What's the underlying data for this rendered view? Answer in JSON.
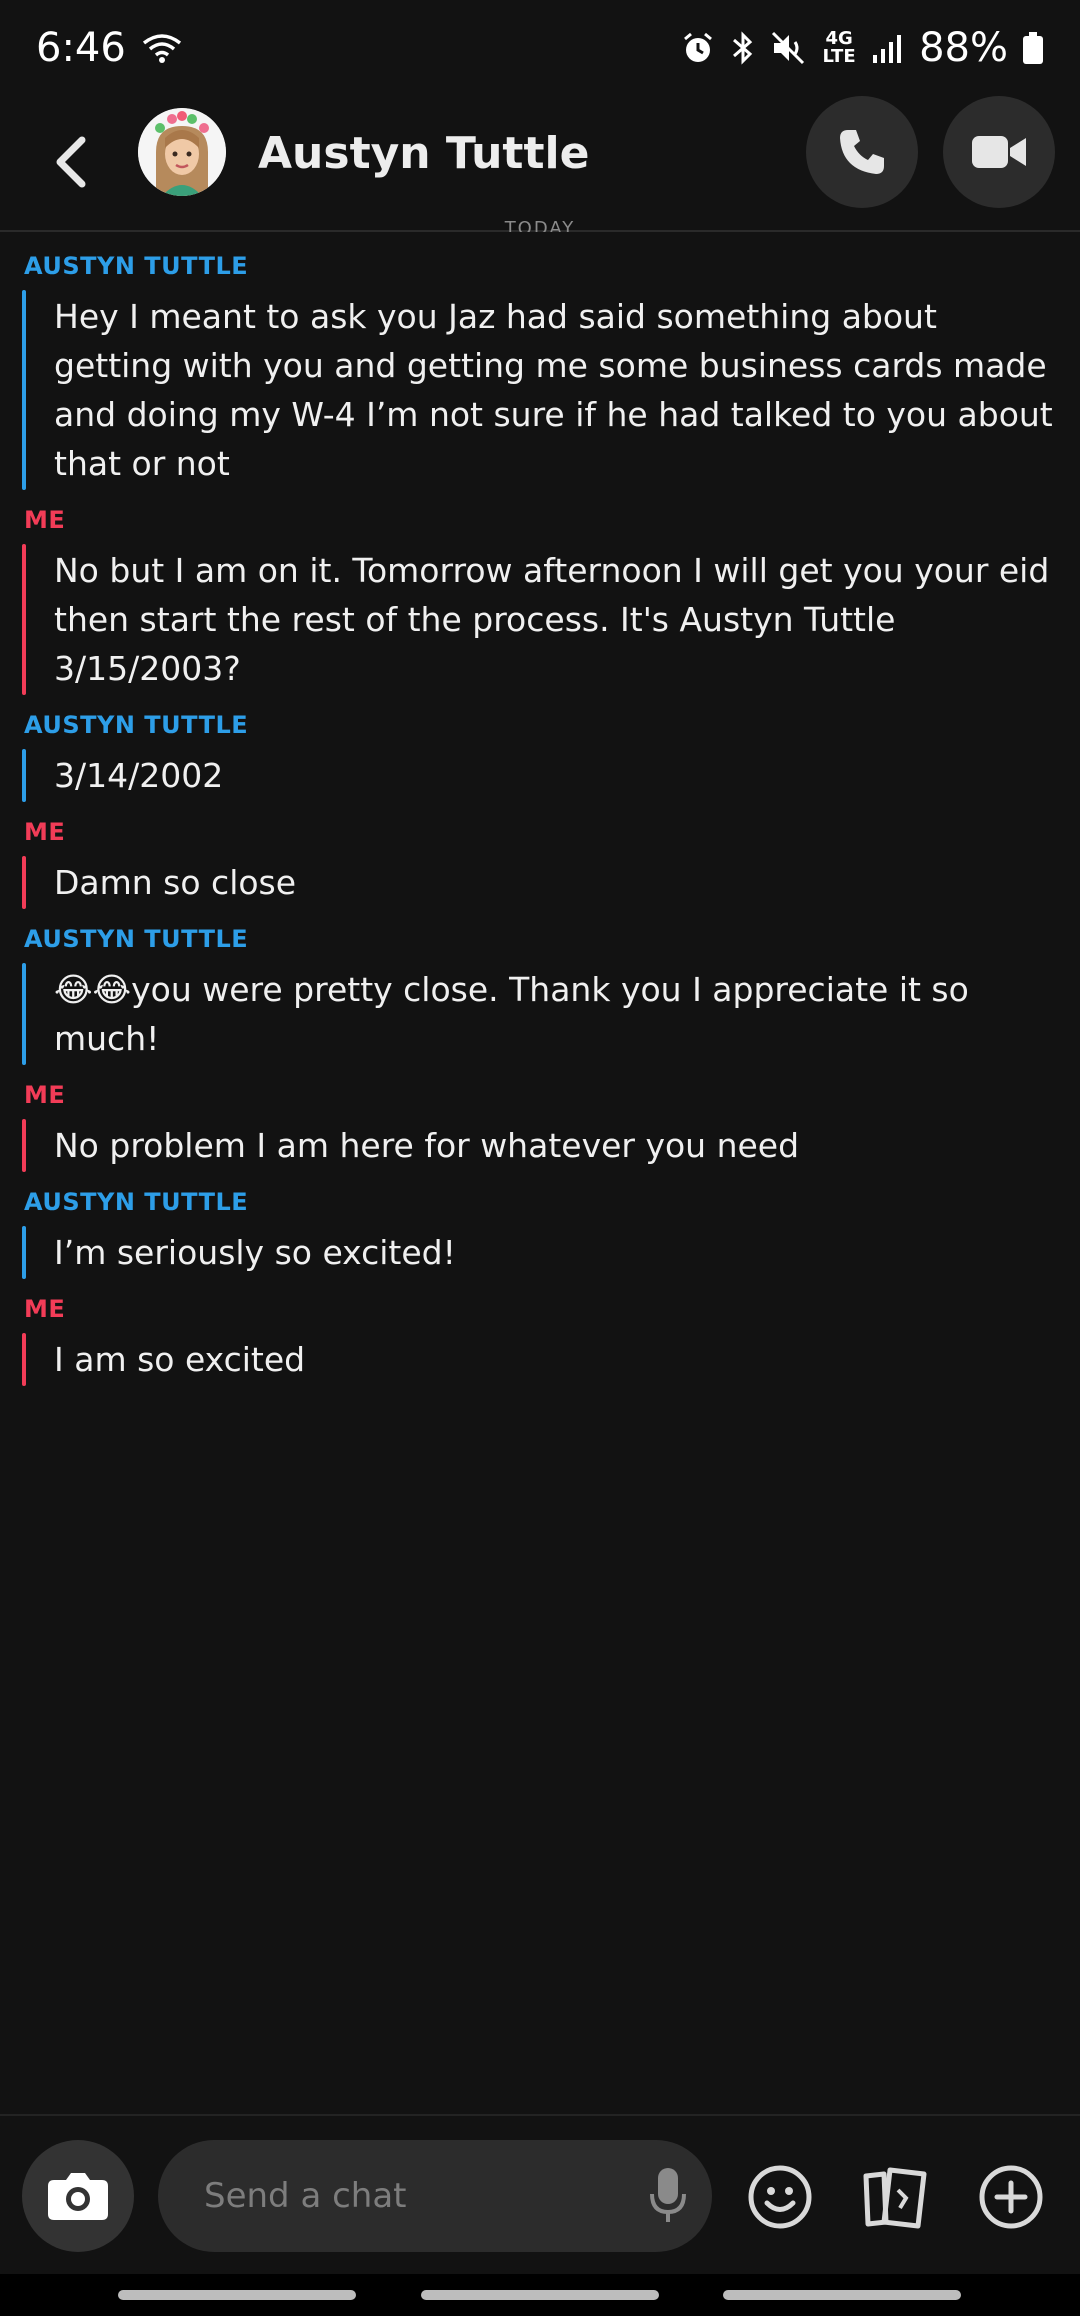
{
  "status": {
    "time": "6:46",
    "network": "4G LTE",
    "battery": "88%"
  },
  "header": {
    "contact_name": "Austyn Tuttle",
    "date_divider": "TODAY"
  },
  "messages": [
    {
      "sender": "AUSTYN TUTTLE",
      "side": "them",
      "text": "Hey I meant to ask you Jaz had said something about getting with you and getting me some business cards made and doing my W-4 I’m not sure if he had talked to you about that or not"
    },
    {
      "sender": "ME",
      "side": "me",
      "text": "No but I am on it. Tomorrow afternoon I will get you your eid then start the rest of the process. It's Austyn Tuttle 3/15/2003?"
    },
    {
      "sender": "AUSTYN TUTTLE",
      "side": "them",
      "text": "3/14/2002"
    },
    {
      "sender": "ME",
      "side": "me",
      "text": "Damn so close"
    },
    {
      "sender": "AUSTYN TUTTLE",
      "side": "them",
      "text": "😂😂you were pretty close. Thank you I appreciate it so much!"
    },
    {
      "sender": "ME",
      "side": "me",
      "text": "No problem I am here for whatever you need"
    },
    {
      "sender": "AUSTYN TUTTLE",
      "side": "them",
      "text": "I’m seriously so excited!"
    },
    {
      "sender": "ME",
      "side": "me",
      "text": "I am so excited"
    }
  ],
  "composer": {
    "placeholder": "Send a chat",
    "value": ""
  },
  "icons": {
    "back": "chevron-left-icon",
    "call": "phone-icon",
    "video": "video-camera-icon",
    "camera": "camera-icon",
    "mic": "microphone-icon",
    "emoji": "smiley-icon",
    "cards": "cards-icon",
    "plus": "plus-circle-icon"
  },
  "colors": {
    "background": "#121212",
    "them_accent": "#2d9ee8",
    "me_accent": "#f23c57"
  }
}
